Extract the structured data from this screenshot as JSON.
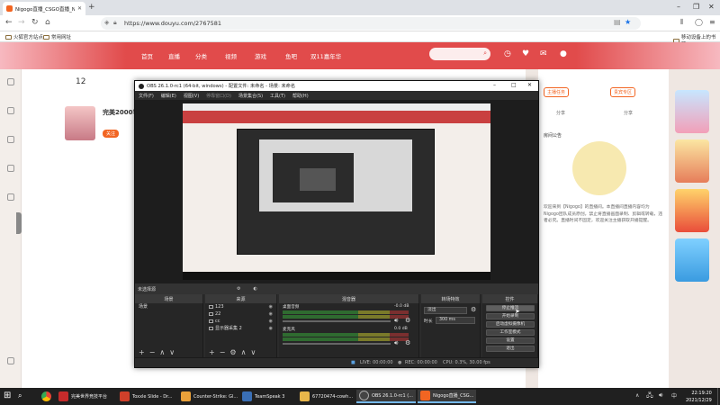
{
  "browser": {
    "tab_title": "Nigogo直播_CSGO直播_Nigo",
    "url": "https://www.douyu.com/2767581",
    "bookmarks": [
      "火狐官方站点",
      "常用网址"
    ],
    "bookmark_right": "移动设备上的书签"
  },
  "site": {
    "nav": [
      "首页",
      "直播",
      "分类",
      "视频",
      "游戏",
      "鱼吧",
      "双11嘉年华"
    ],
    "room_count": "12",
    "streamer_name": "完美2000学",
    "follow_label": "关注",
    "right_buttons": [
      "主播任务",
      "贵宾专区",
      "分享",
      "分享"
    ],
    "right_heading": "房间公告",
    "right_note": "欢迎来到【Nigogo】的直播间。本直播间直播内容均为Nigogo团队成员原创，禁止将直播画面录制、剪辑或转载，违者必究。直播时间不固定，欢迎关注主播获取开播提醒。"
  },
  "obs": {
    "title": "OBS 26.1.0-rc1 (64-bit, windows) - 配置文件: 未命名 - 场景: 未命名",
    "menu": [
      "文件(F)",
      "编辑(E)",
      "视图(V)",
      "停靠窗口(D)",
      "场景集合(S)",
      "工具(T)",
      "帮助(H)"
    ],
    "scene_bar_label": "未选择源",
    "dock_titles": {
      "scenes": "场景",
      "sources": "来源",
      "mixer": "混音器",
      "transitions": "转场特效",
      "controls": "控件"
    },
    "scenes": [
      "场景"
    ],
    "sources": [
      "123",
      "22",
      "cc",
      "显示器采集 2"
    ],
    "mixer": [
      {
        "name": "桌面音频",
        "db": "-0.0 dB"
      },
      {
        "name": "麦克风",
        "db": "0.0 dB"
      }
    ],
    "transition": {
      "type": "淡出",
      "duration_label": "时长",
      "duration": "300 ms"
    },
    "controls": [
      "停止推流",
      "开始录制",
      "启动虚拟摄像机",
      "工作室模式",
      "设置",
      "退出"
    ],
    "status": {
      "live": "LIVE: 00:00:00",
      "rec": "REC: 00:00:00",
      "cpu": "CPU: 0.3%, 30.00 fps"
    }
  },
  "taskbar": {
    "apps": [
      {
        "label": "完美世界竞技平台",
        "color": "#c52b2b"
      },
      {
        "label": "Toxxle Slide - Dr...",
        "color": "#d0402a"
      },
      {
        "label": "Counter-Strike: Gl...",
        "color": "#e9a13a"
      },
      {
        "label": "TeamSpeak 3",
        "color": "#3a6fb5"
      },
      {
        "label": "67720474-cowh...",
        "color": "#e8b64a"
      },
      {
        "label": "OBS 26.1.0-rc1 (...",
        "color": "#444444"
      },
      {
        "label": "Nigogo直播_CSG...",
        "color": "#f26522"
      }
    ],
    "time": "22:19:20",
    "date": "2021/12/29"
  }
}
